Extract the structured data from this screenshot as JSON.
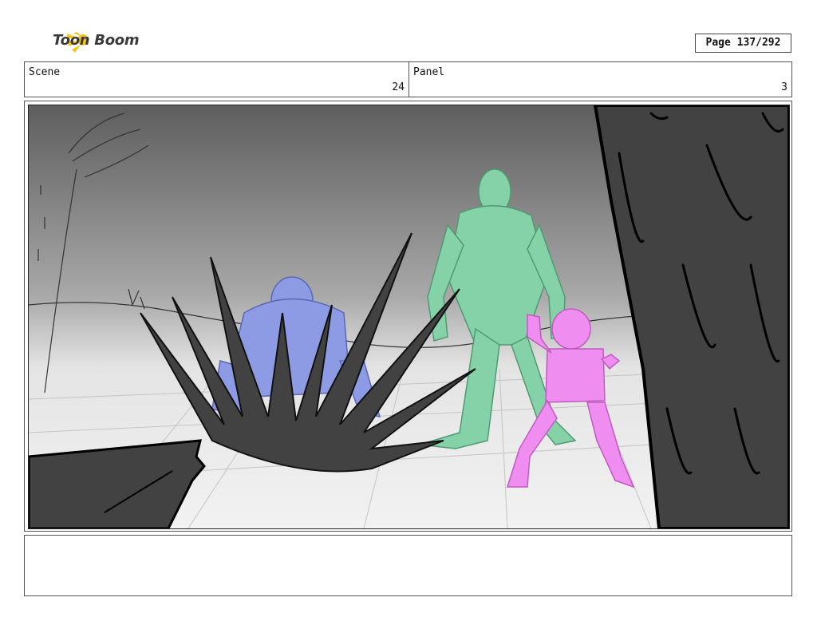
{
  "header": {
    "brand": "Toon Boom",
    "page_label": "Page 137/292"
  },
  "scene": {
    "label": "Scene",
    "value": "24"
  },
  "panel": {
    "label": "Panel",
    "value": "3"
  },
  "frame": {
    "colors": {
      "blue_figure": "#8c9be3",
      "green_figure": "#86d2a8",
      "pink_figure": "#f08df0",
      "dark_foreground": "#424242"
    }
  },
  "notes": {
    "text": ""
  }
}
